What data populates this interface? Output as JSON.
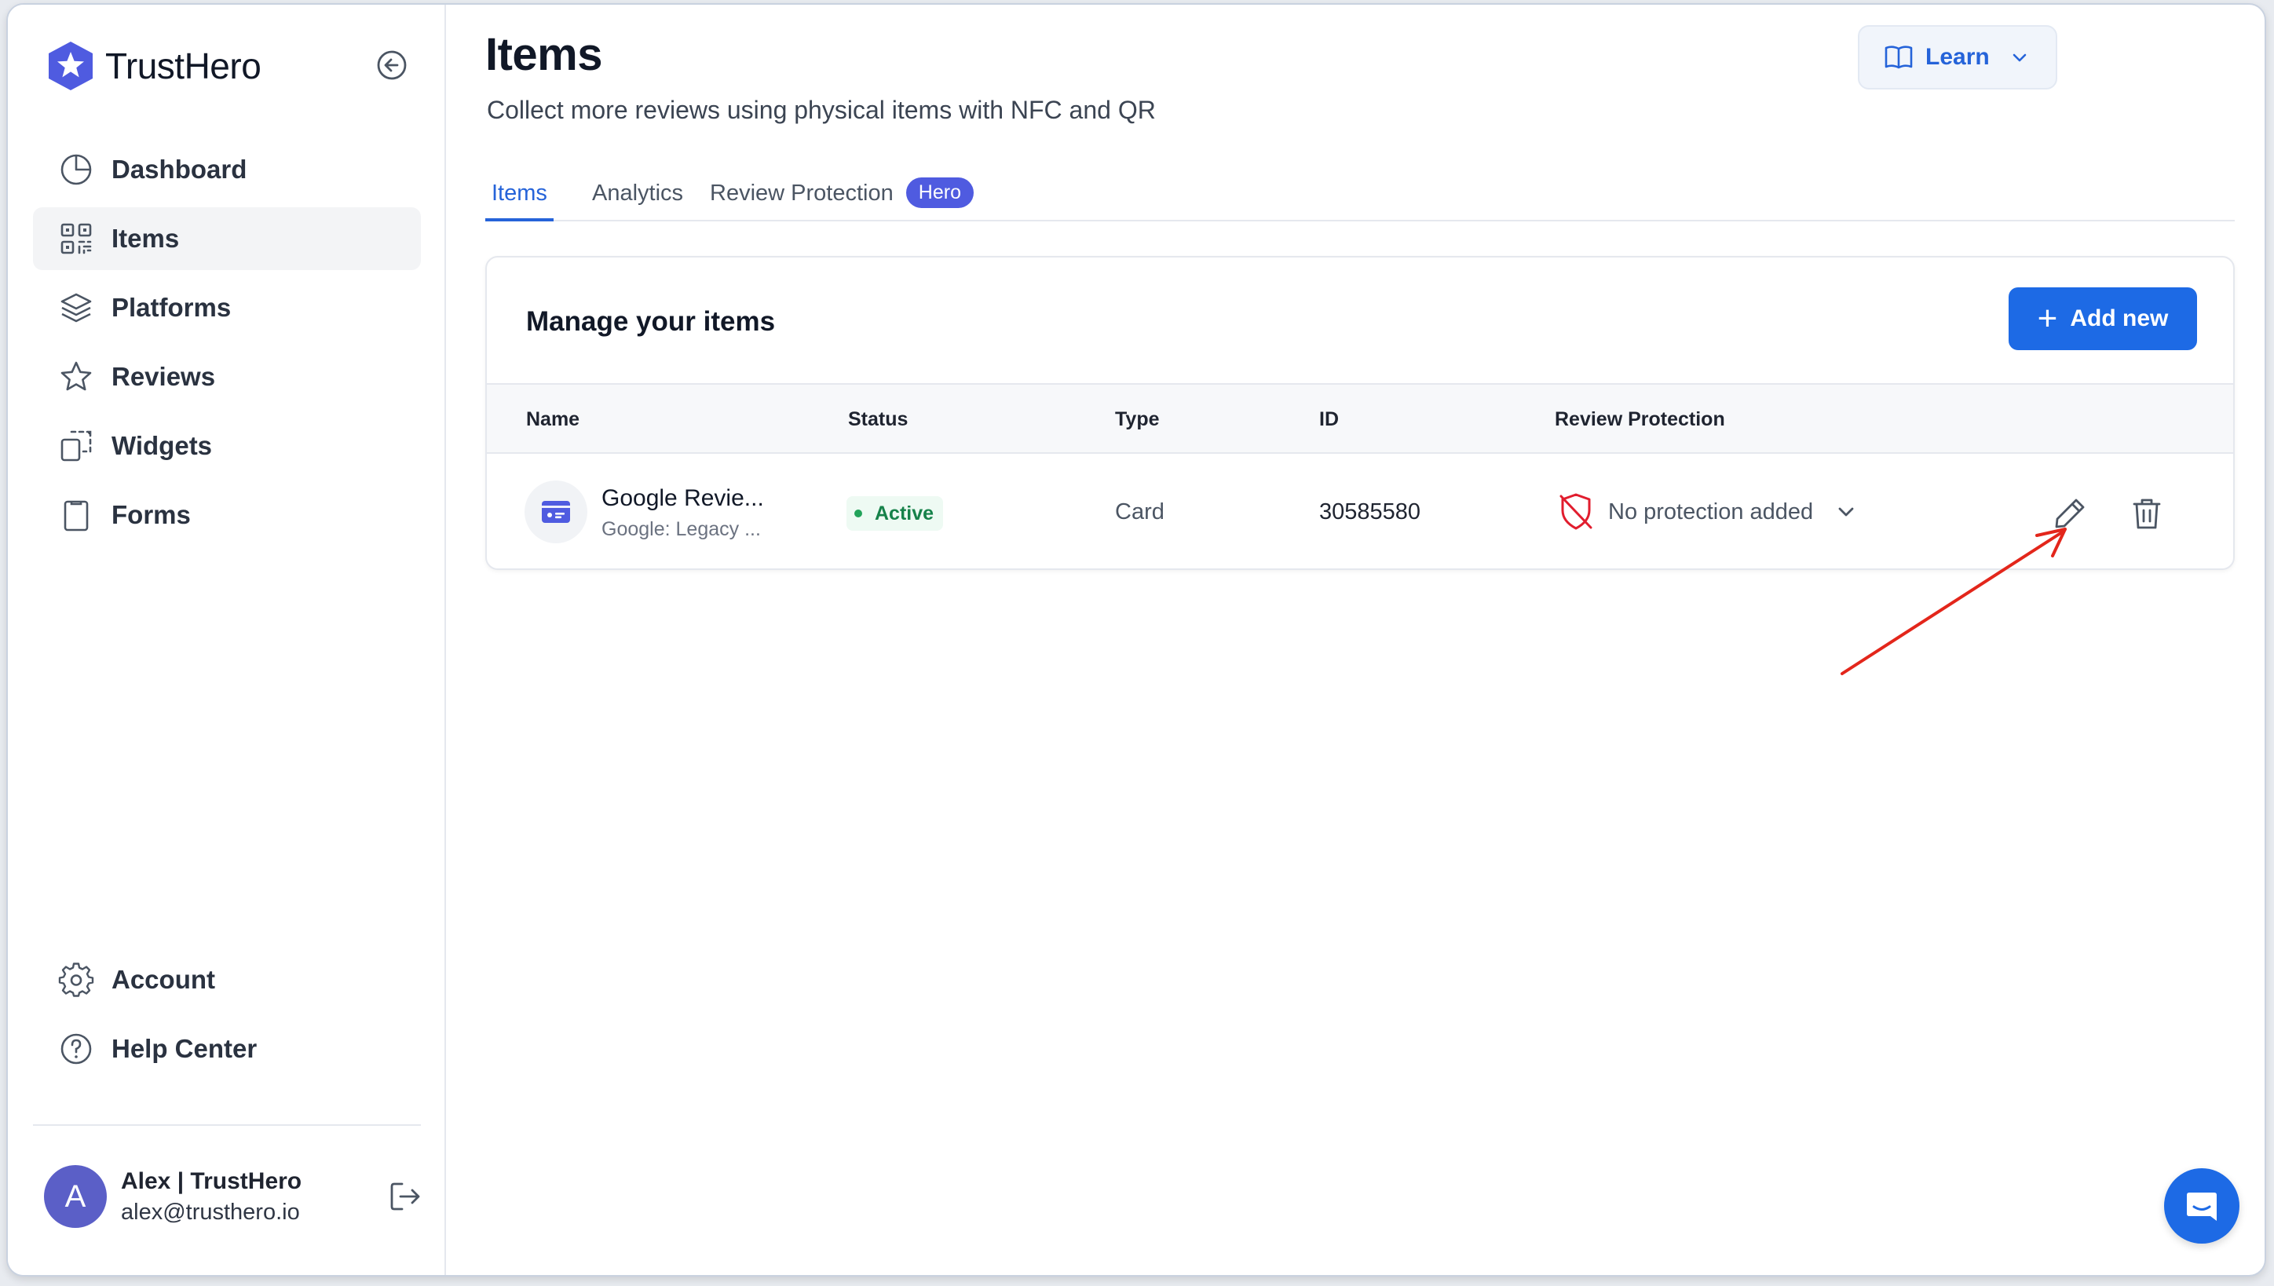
{
  "app": {
    "name": "TrustHero"
  },
  "sidebar": {
    "items": [
      {
        "label": "Dashboard",
        "icon": "pie-chart-icon"
      },
      {
        "label": "Items",
        "icon": "qr-code-icon",
        "active": true
      },
      {
        "label": "Platforms",
        "icon": "layers-icon"
      },
      {
        "label": "Reviews",
        "icon": "star-icon"
      },
      {
        "label": "Widgets",
        "icon": "widgets-icon"
      },
      {
        "label": "Forms",
        "icon": "clipboard-icon"
      }
    ],
    "bottom_items": [
      {
        "label": "Account",
        "icon": "gear-icon"
      },
      {
        "label": "Help Center",
        "icon": "help-icon"
      }
    ],
    "user": {
      "initial": "A",
      "name": "Alex | TrustHero",
      "email": "alex@trusthero.io"
    }
  },
  "header": {
    "title": "Items",
    "subtitle": "Collect more reviews using physical items with NFC and QR",
    "learn_label": "Learn"
  },
  "tabs": [
    {
      "label": "Items",
      "active": true
    },
    {
      "label": "Analytics"
    },
    {
      "label": "Review Protection",
      "badge": "Hero"
    }
  ],
  "card": {
    "title": "Manage your items",
    "add_label": "Add new",
    "columns": [
      "Name",
      "Status",
      "Type",
      "ID",
      "Review Protection"
    ],
    "rows": [
      {
        "name": "Google Revie...",
        "description": "Google: Legacy ...",
        "status": "Active",
        "type": "Card",
        "id": "30585580",
        "protection": "No protection added"
      }
    ]
  },
  "colors": {
    "accent": "#1d6ae5",
    "tab_active": "#2563d9",
    "badge": "#4f5be0",
    "status_active": "#16824a",
    "danger": "#e11d2e",
    "annotation_arrow": "#e3261b"
  }
}
